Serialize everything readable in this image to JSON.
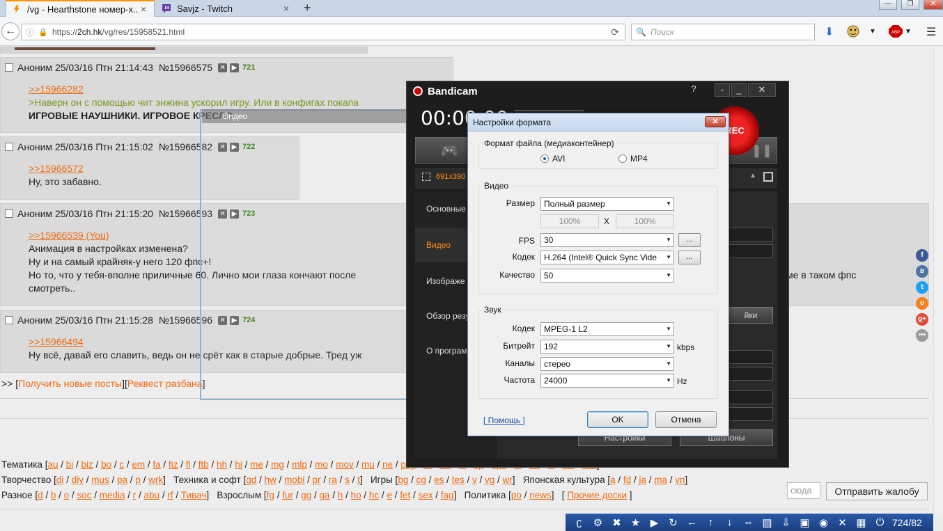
{
  "browser": {
    "tabs": [
      {
        "label": "/vg - Hearthstone номер-х...",
        "close": "×"
      },
      {
        "label": "Savjz - Twitch",
        "close": "×"
      }
    ],
    "new_tab": "+",
    "window_buttons": [
      "—",
      "❐",
      "✕"
    ],
    "url_scheme": "https://",
    "url_host": "2ch.hk",
    "url_path": "/vg/res/15958521.html",
    "search_placeholder": "Поиск"
  },
  "posts": [
    {
      "author": "Аноним",
      "date": "25/03/16 Птн 21:14:43",
      "num": "№15966575",
      "index": "721",
      "lines": [
        {
          "type": "ref",
          "text": ">>15966282"
        },
        {
          "type": "green",
          "text": ">Наверн он с помощью чит энжина ускорил игру. Или в конфигах покапа"
        },
        {
          "type": "bold",
          "text": "ИГРОВЫЕ НАУШНИКИ. ИГРОВОЕ КРЕСЛО."
        }
      ]
    },
    {
      "author": "Аноним",
      "date": "25/03/16 Птн 21:15:02",
      "num": "№15966582",
      "index": "722",
      "lines": [
        {
          "type": "ref",
          "text": ">>15966572"
        },
        {
          "type": "text",
          "text": "Ну, это забавно."
        }
      ]
    },
    {
      "author": "Аноним",
      "date": "25/03/16 Птн 21:15:20",
      "num": "№15966593",
      "index": "723",
      "lines": [
        {
          "type": "ref",
          "text": ">>15966539 (You)"
        },
        {
          "type": "text",
          "text": "Анимация в настройках изменена?"
        },
        {
          "type": "text",
          "text": "Ну и на самый крайняк-у него 120 фпс+!"
        },
        {
          "type": "text",
          "text": "Но то, что у тебя-вполне приличные 60. Лично мои глаза кончают после"
        },
        {
          "type": "text",
          "text": "смотреть.."
        }
      ],
      "overflow_text": "ме в таком фпс"
    },
    {
      "author": "Аноним",
      "date": "25/03/16 Птн 21:15:28",
      "num": "№15966596",
      "index": "724",
      "lines": [
        {
          "type": "ref",
          "text": ">>15966494"
        },
        {
          "type": "text",
          "text": "Ну всё, давай его славить, ведь он не срёт как в старые добрые. Тред уж"
        }
      ]
    }
  ],
  "thread_footer": {
    "prefix": ">>",
    "get_new": "Получить новые посты",
    "unban": "Реквест разбана"
  },
  "boards": {
    "row1_label": "Тематика",
    "row1": [
      "au",
      "bi",
      "biz",
      "bo",
      "c",
      "em",
      "fa",
      "fiz",
      "fl",
      "ftb",
      "hh",
      "hi",
      "me",
      "mg",
      "mlp",
      "mo",
      "mov",
      "mu",
      "ne",
      "psy",
      "re",
      "sci",
      "sf",
      "sp",
      "spc",
      "tv",
      "un",
      "w",
      "wh",
      "wm"
    ],
    "row2": [
      {
        "label": "Творчество",
        "items": [
          "di",
          "diy",
          "mus",
          "pa",
          "p",
          "wrk"
        ]
      },
      {
        "label": "Техника и софт",
        "items": [
          "gd",
          "hw",
          "mobi",
          "pr",
          "ra",
          "s",
          "t"
        ]
      },
      {
        "label": "Игры",
        "items": [
          "bg",
          "cg",
          "es",
          "tes",
          "v",
          "vg",
          "wr"
        ]
      },
      {
        "label": "Японская культура",
        "items": [
          "a",
          "fd",
          "ja",
          "ma",
          "vn"
        ]
      }
    ],
    "row3": [
      {
        "label": "Разное",
        "items": [
          "d",
          "b",
          "o",
          "soc",
          "media",
          "r",
          "abu",
          "rf",
          "Тивач"
        ]
      },
      {
        "label": "Взрослым",
        "items": [
          "fg",
          "fur",
          "gg",
          "ga",
          "h",
          "ho",
          "hc",
          "e",
          "fet",
          "sex",
          "fag"
        ]
      },
      {
        "label": "Политика",
        "items": [
          "po",
          "news"
        ]
      }
    ],
    "other_boards": "Прочие доски"
  },
  "report": {
    "input_placeholder": "сюда",
    "button": "Отправить жалобу"
  },
  "bottom_toolbar": {
    "counter": "724/82"
  },
  "selection_label": "Видео",
  "bandicam": {
    "title": "Bandicam",
    "help": "?",
    "timer": "00:00:00",
    "rec": "REC",
    "resolution": "691x390",
    "side_items": [
      "Основные",
      "Видео",
      "Изображе",
      "Обзор резул",
      "О програм"
    ],
    "settings_btn_partial": "йки",
    "settings_btn": "Настройки",
    "templates_btn": "Шаблоны"
  },
  "dialog": {
    "title": "Настройки формата",
    "close": "✕",
    "file_format_group": "Формат файла (медиаконтейнер)",
    "formats": [
      {
        "label": "AVI",
        "selected": true
      },
      {
        "label": "MP4",
        "selected": false
      }
    ],
    "video_group": "Видео",
    "size_label": "Размер",
    "size_value": "Полный размер",
    "width_pct": "100%",
    "x": "X",
    "height_pct": "100%",
    "fps_label": "FPS",
    "fps_value": "30",
    "codec_label": "Кодек",
    "codec_value": "H.264 (Intel® Quick Sync Vide",
    "quality_label": "Качество",
    "quality_value": "50",
    "more": "...",
    "audio_group": "Звук",
    "audio_codec_label": "Кодек",
    "audio_codec_value": "MPEG-1 L2",
    "bitrate_label": "Битрейт",
    "bitrate_value": "192",
    "bitrate_unit": "kbps",
    "channels_label": "Каналы",
    "channels_value": "стерео",
    "freq_label": "Частота",
    "freq_value": "24000",
    "freq_unit": "Hz",
    "help": "[ Помощь ]",
    "ok": "OK",
    "cancel": "Отмена"
  }
}
